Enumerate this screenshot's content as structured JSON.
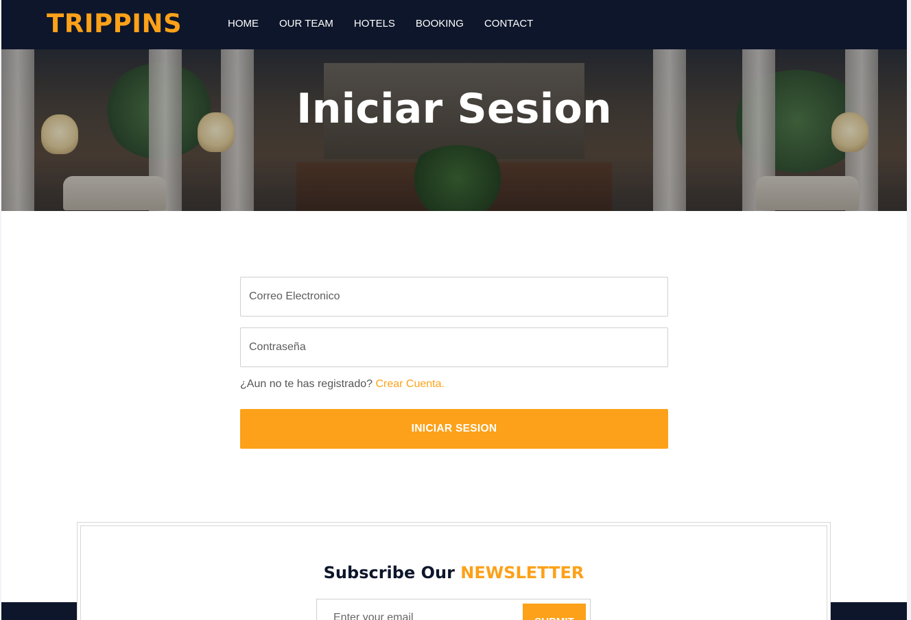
{
  "brand": {
    "name": "TRIPPINS"
  },
  "nav": {
    "items": [
      "HOME",
      "OUR TEAM",
      "HOTELS",
      "BOOKING",
      "CONTACT"
    ]
  },
  "hero": {
    "title": "Iniciar Sesion"
  },
  "login": {
    "email_placeholder": "Correo Electronico",
    "password_placeholder": "Contraseña",
    "register_prompt": "¿Aun no te has registrado?",
    "register_link": "Crear Cuenta.",
    "submit_label": "INICIAR SESION"
  },
  "newsletter": {
    "title_prefix": "Subscribe Our",
    "title_highlight": "NEWSLETTER",
    "email_placeholder": "Enter your email",
    "submit_label": "SUBMIT"
  },
  "colors": {
    "accent": "#fca119",
    "navy": "#0e162b"
  }
}
